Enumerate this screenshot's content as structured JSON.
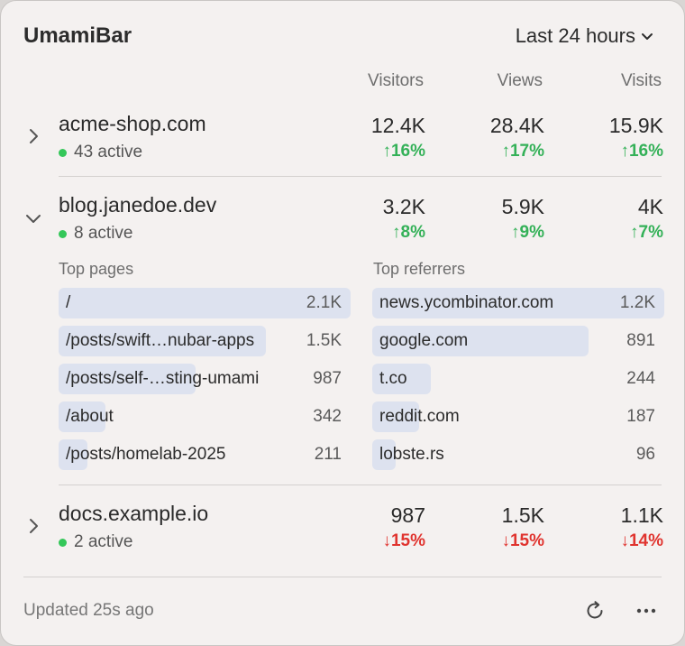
{
  "app": {
    "title": "UmamiBar"
  },
  "range": {
    "label": "Last 24 hours"
  },
  "columns": [
    "Visitors",
    "Views",
    "Visits"
  ],
  "sites": [
    {
      "name": "acme-shop.com",
      "active": "43 active",
      "expanded": false,
      "metrics": [
        {
          "value": "12.4K",
          "delta": "↑16%",
          "dir": "up"
        },
        {
          "value": "28.4K",
          "delta": "↑17%",
          "dir": "up"
        },
        {
          "value": "15.9K",
          "delta": "↑16%",
          "dir": "up"
        }
      ]
    },
    {
      "name": "blog.janedoe.dev",
      "active": "8 active",
      "expanded": true,
      "metrics": [
        {
          "value": "3.2K",
          "delta": "↑8%",
          "dir": "up"
        },
        {
          "value": "5.9K",
          "delta": "↑9%",
          "dir": "up"
        },
        {
          "value": "4K",
          "delta": "↑7%",
          "dir": "up"
        }
      ],
      "top_pages_title": "Top pages",
      "top_pages": [
        {
          "label": "/",
          "value": "2.1K",
          "share": 1.0
        },
        {
          "label": "/posts/swift…nubar-apps",
          "value": "1.5K",
          "share": 0.71
        },
        {
          "label": "/posts/self-…sting-umami",
          "value": "987",
          "share": 0.47
        },
        {
          "label": "/about",
          "value": "342",
          "share": 0.16
        },
        {
          "label": "/posts/homelab-2025",
          "value": "211",
          "share": 0.1
        }
      ],
      "top_referrers_title": "Top referrers",
      "top_referrers": [
        {
          "label": "news.ycombinator.com",
          "value": "1.2K",
          "share": 1.0
        },
        {
          "label": "google.com",
          "value": "891",
          "share": 0.74
        },
        {
          "label": "t.co",
          "value": "244",
          "share": 0.2
        },
        {
          "label": "reddit.com",
          "value": "187",
          "share": 0.16
        },
        {
          "label": "lobste.rs",
          "value": "96",
          "share": 0.08
        }
      ]
    },
    {
      "name": "docs.example.io",
      "active": "2 active",
      "expanded": false,
      "metrics": [
        {
          "value": "987",
          "delta": "↓15%",
          "dir": "down"
        },
        {
          "value": "1.5K",
          "delta": "↓15%",
          "dir": "down"
        },
        {
          "value": "1.1K",
          "delta": "↓14%",
          "dir": "down"
        }
      ]
    }
  ],
  "footer": {
    "updated": "Updated 25s ago"
  },
  "colors": {
    "up": "#34b158",
    "down": "#e0342f",
    "active_dot": "#34c759",
    "bar": "#dde2ef"
  },
  "icons": [
    "chevron-down-icon",
    "chevron-right-icon",
    "refresh-icon",
    "more-icon"
  ]
}
